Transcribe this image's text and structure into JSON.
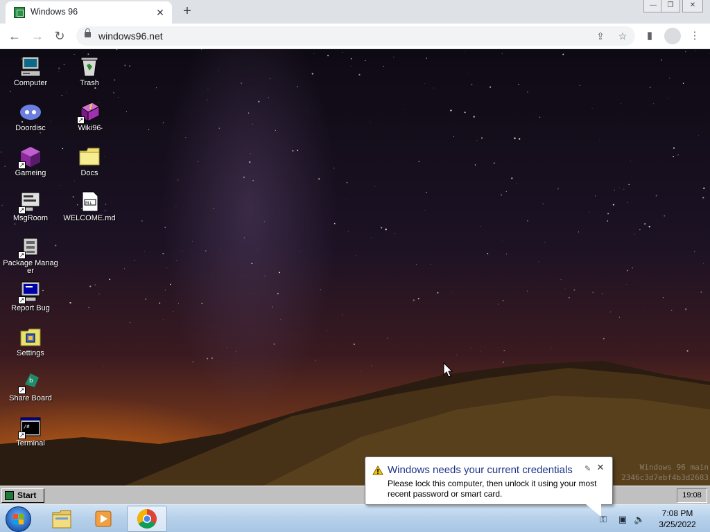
{
  "browser": {
    "tab_title": "Windows 96",
    "tab_close": "✕",
    "new_tab": "+",
    "url": "windows96.net",
    "nav": {
      "back": "←",
      "forward": "→",
      "reload": "↻"
    },
    "window_controls": {
      "minimize": "—",
      "restore": "❐",
      "close": "✕"
    },
    "toolbar_icons": {
      "share": "⇪",
      "bookmark": "☆",
      "side_panel": "▮",
      "menu": "⋮"
    }
  },
  "desktop": {
    "icons": [
      {
        "label": "Computer",
        "icon": "computer-icon",
        "shortcut": false
      },
      {
        "label": "Trash",
        "icon": "trash-icon",
        "shortcut": false
      },
      {
        "label": "Doordisc",
        "icon": "discord-icon",
        "shortcut": false
      },
      {
        "label": "Wiki96",
        "icon": "help-book-icon",
        "shortcut": true
      },
      {
        "label": "Gameing",
        "icon": "cube-icon",
        "shortcut": true
      },
      {
        "label": "Docs",
        "icon": "folder-icon",
        "shortcut": false
      },
      {
        "label": "MsgRoom",
        "icon": "chat-icon",
        "shortcut": true
      },
      {
        "label": "WELCOME.md",
        "icon": "markdown-file-icon",
        "shortcut": false
      },
      {
        "label": "Package Manager",
        "icon": "package-icon",
        "shortcut": true
      },
      {
        "label": "Report Bug",
        "icon": "monitor-bug-icon",
        "shortcut": true
      },
      {
        "label": "Settings",
        "icon": "settings-folder-icon",
        "shortcut": false
      },
      {
        "label": "Share Board",
        "icon": "share-board-icon",
        "shortcut": true
      },
      {
        "label": "Terminal",
        "icon": "terminal-icon",
        "shortcut": true
      }
    ],
    "watermark_line1": "Windows 96 main",
    "watermark_line2": "2346c3d7ebf4b3d2683"
  },
  "w96_taskbar": {
    "start_label": "Start",
    "clock": "19:08"
  },
  "win7_taskbar": {
    "time": "7:08 PM",
    "date": "3/25/2022",
    "apps": [
      "explorer-icon",
      "media-player-icon",
      "chrome-icon"
    ]
  },
  "balloon": {
    "title": "Windows needs your current credentials",
    "text": "Please lock this computer, then unlock it using your most recent password or smart card.",
    "close": "✕",
    "options": "✎"
  },
  "colors": {
    "balloon_title": "#1e3287",
    "w96_gray": "#c0c0c0",
    "chrome_frame": "#dee1e6"
  }
}
